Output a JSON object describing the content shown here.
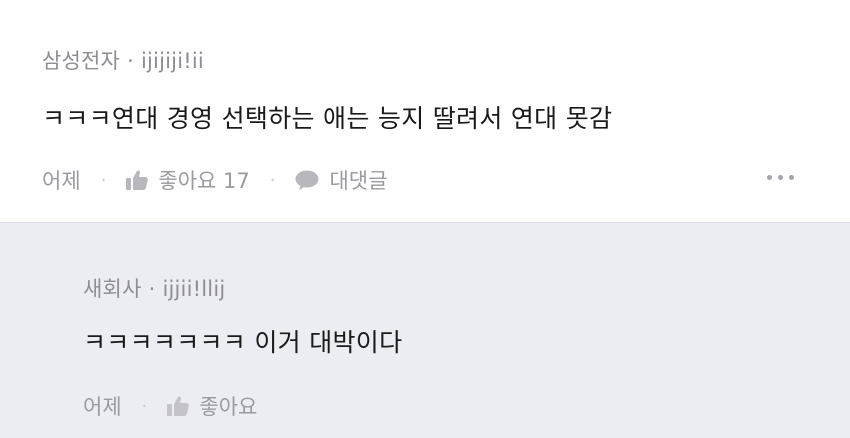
{
  "comment": {
    "company": "삼성전자",
    "separator": "·",
    "username": "ijijiji!ii",
    "text": "ㅋㅋㅋ연대 경영 선택하는 애는 능지 딸려서 연대 못감",
    "time": "어제",
    "like_label": "좋아요 17",
    "reply_label": "대댓글",
    "icons": {
      "like": "thumbs-up-icon",
      "reply": "speech-bubble-icon",
      "more": "more-dots-icon"
    }
  },
  "reply": {
    "company": "새회사",
    "separator": "·",
    "username": "ijjii!llij",
    "text": "ㅋㅋㅋㅋㅋㅋㅋ 이거 대박이다",
    "time": "어제",
    "like_label": "좋아요",
    "icons": {
      "like": "thumbs-up-icon"
    }
  },
  "colors": {
    "reply_background": "#ecedf2",
    "meta_text": "#8d8d93",
    "body_text": "#1a1a1a"
  }
}
